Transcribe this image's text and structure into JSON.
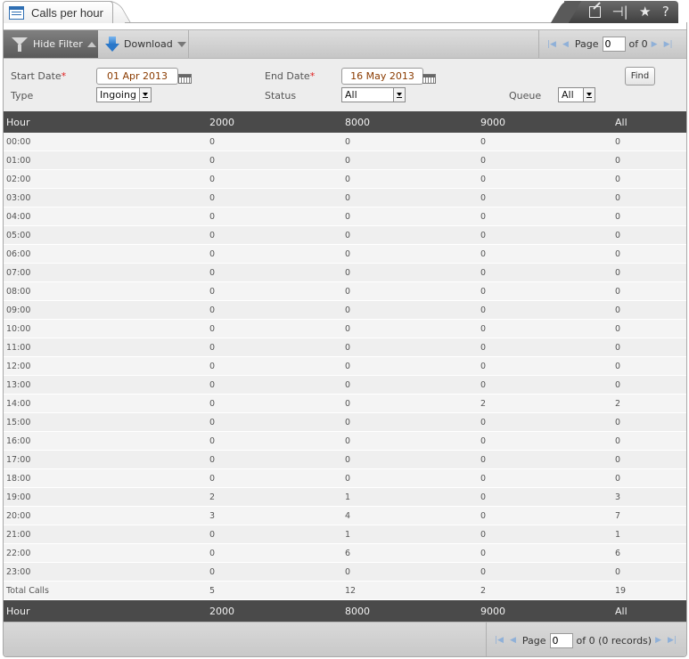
{
  "tab": {
    "title": "Calls per hour",
    "icon": "table-icon"
  },
  "tools": {
    "edit": "edit-icon",
    "pin": "⊣|",
    "star": "★",
    "help": "?"
  },
  "toolbar": {
    "hide_filter_label": "Hide Filter",
    "download_label": "Download"
  },
  "pager_top": {
    "page_label": "Page",
    "page_value": "0",
    "of_label": "of 0"
  },
  "filter": {
    "start_date_label": "Start Date",
    "start_date_value": "01 Apr 2013",
    "end_date_label": "End Date",
    "end_date_value": "16 May 2013",
    "required_mark": "*",
    "type_label": "Type",
    "type_value": "Ingoing",
    "status_label": "Status",
    "status_value": "All",
    "queue_label": "Queue",
    "queue_value": "All",
    "find_label": "Find"
  },
  "table": {
    "columns": [
      "Hour",
      "2000",
      "8000",
      "9000",
      "All"
    ],
    "rows": [
      [
        "00:00",
        "0",
        "0",
        "0",
        "0"
      ],
      [
        "01:00",
        "0",
        "0",
        "0",
        "0"
      ],
      [
        "02:00",
        "0",
        "0",
        "0",
        "0"
      ],
      [
        "03:00",
        "0",
        "0",
        "0",
        "0"
      ],
      [
        "04:00",
        "0",
        "0",
        "0",
        "0"
      ],
      [
        "05:00",
        "0",
        "0",
        "0",
        "0"
      ],
      [
        "06:00",
        "0",
        "0",
        "0",
        "0"
      ],
      [
        "07:00",
        "0",
        "0",
        "0",
        "0"
      ],
      [
        "08:00",
        "0",
        "0",
        "0",
        "0"
      ],
      [
        "09:00",
        "0",
        "0",
        "0",
        "0"
      ],
      [
        "10:00",
        "0",
        "0",
        "0",
        "0"
      ],
      [
        "11:00",
        "0",
        "0",
        "0",
        "0"
      ],
      [
        "12:00",
        "0",
        "0",
        "0",
        "0"
      ],
      [
        "13:00",
        "0",
        "0",
        "0",
        "0"
      ],
      [
        "14:00",
        "0",
        "0",
        "2",
        "2"
      ],
      [
        "15:00",
        "0",
        "0",
        "0",
        "0"
      ],
      [
        "16:00",
        "0",
        "0",
        "0",
        "0"
      ],
      [
        "17:00",
        "0",
        "0",
        "0",
        "0"
      ],
      [
        "18:00",
        "0",
        "0",
        "0",
        "0"
      ],
      [
        "19:00",
        "2",
        "1",
        "0",
        "3"
      ],
      [
        "20:00",
        "3",
        "4",
        "0",
        "7"
      ],
      [
        "21:00",
        "0",
        "1",
        "0",
        "1"
      ],
      [
        "22:00",
        "0",
        "6",
        "0",
        "6"
      ],
      [
        "23:00",
        "0",
        "0",
        "0",
        "0"
      ],
      [
        "Total Calls",
        "5",
        "12",
        "2",
        "19"
      ]
    ]
  },
  "pager_bottom": {
    "page_label": "Page",
    "page_value": "0",
    "of_label": "of 0 (0 records)"
  },
  "colors": {
    "header_bg": "#4a4a4a",
    "accent": "#2a77c9",
    "required": "#e02020",
    "date_text": "#8a3b00"
  }
}
